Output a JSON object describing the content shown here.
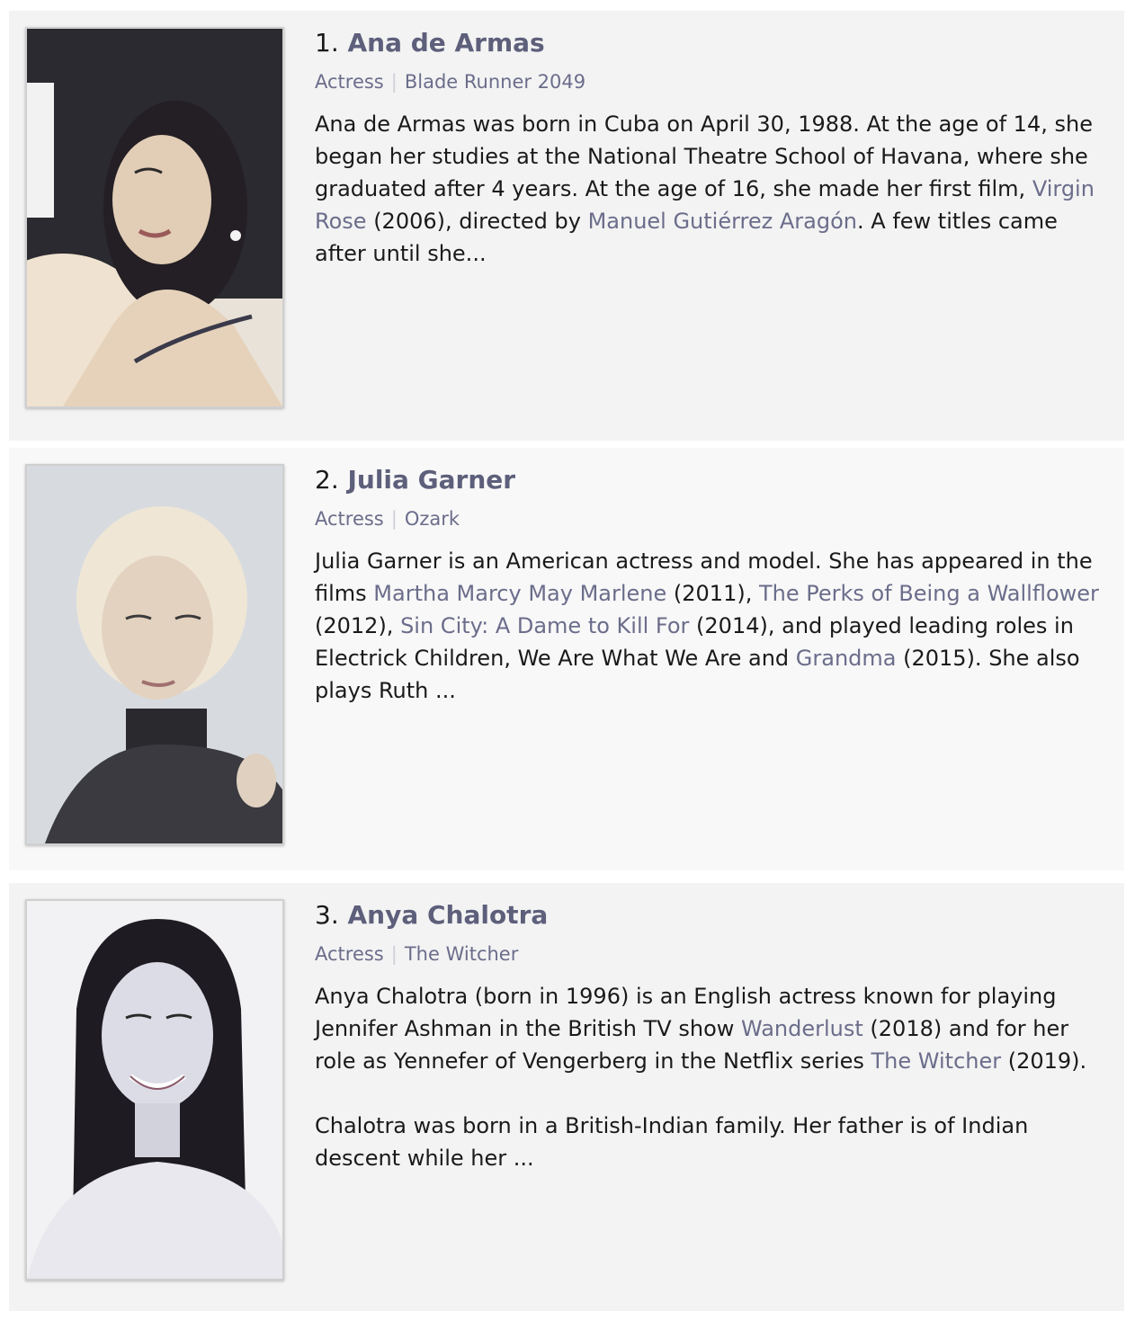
{
  "items": [
    {
      "index": "1.",
      "name": "Ana de Armas",
      "profession": "Actress",
      "known_for": "Blade Runner 2049",
      "bio": [
        [
          {
            "t": "Ana de Armas was born in Cuba on April 30, 1988. At the age of 14, she began her studies at the National Theatre School of Havana, where she graduated after 4 years. At the age of 16, she made her first film, "
          },
          {
            "t": "Virgin Rose",
            "link": true
          },
          {
            "t": " (2006), directed by "
          },
          {
            "t": "Manuel Gutiérrez Aragón",
            "link": true
          },
          {
            "t": ". A few titles came after until she..."
          }
        ]
      ]
    },
    {
      "index": "2.",
      "name": "Julia Garner",
      "profession": "Actress",
      "known_for": "Ozark",
      "bio": [
        [
          {
            "t": "Julia Garner is an American actress and model. She has appeared in the films "
          },
          {
            "t": "Martha Marcy May Marlene",
            "link": true
          },
          {
            "t": " (2011), "
          },
          {
            "t": "The Perks of Being a Wallflower",
            "link": true
          },
          {
            "t": " (2012), "
          },
          {
            "t": "Sin City: A Dame to Kill For",
            "link": true
          },
          {
            "t": " (2014), and played leading roles in Electrick Children, We Are What We Are and "
          },
          {
            "t": "Grandma",
            "link": true
          },
          {
            "t": " (2015). She also plays Ruth ..."
          }
        ]
      ]
    },
    {
      "index": "3.",
      "name": "Anya Chalotra",
      "profession": "Actress",
      "known_for": "The Witcher",
      "bio": [
        [
          {
            "t": "Anya Chalotra (born in 1996) is an English actress known for playing Jennifer Ashman in the British TV show "
          },
          {
            "t": "Wanderlust",
            "link": true
          },
          {
            "t": " (2018) and for her role as Yennefer of Vengerberg in the Netflix series "
          },
          {
            "t": "The Witcher",
            "link": true
          },
          {
            "t": " (2019)."
          }
        ],
        [
          {
            "t": "Chalotra was born in a British-Indian family. Her father is of Indian descent while her ..."
          }
        ]
      ]
    }
  ]
}
